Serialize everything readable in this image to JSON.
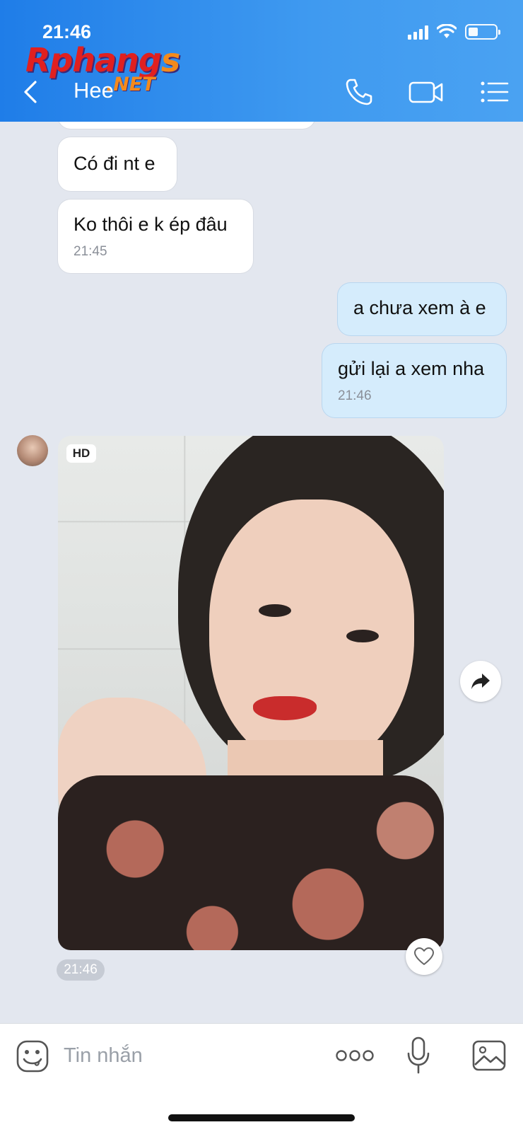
{
  "status_bar": {
    "time": "21:46"
  },
  "watermark": {
    "main": "Rphang",
    "s": "s",
    "suffix": ".NET"
  },
  "header": {
    "title": "Hee",
    "back_icon": "chevron-left-icon",
    "call_icon": "phone-icon",
    "video_icon": "video-camera-icon",
    "menu_icon": "list-menu-icon"
  },
  "messages": [
    {
      "direction": "in",
      "text": "Có đi nt e",
      "time": ""
    },
    {
      "direction": "in",
      "text": "Ko thôi e k ép đâu",
      "time": "21:45"
    },
    {
      "direction": "out",
      "text": "a chưa xem à e",
      "time": ""
    },
    {
      "direction": "out",
      "text": "gửi lại a xem nha",
      "time": "21:46"
    }
  ],
  "photo_message": {
    "badge": "HD",
    "time": "21:46",
    "like_icon": "heart-icon",
    "share_icon": "share-arrow-icon"
  },
  "input_bar": {
    "placeholder": "Tin nhắn",
    "emoji_icon": "emoji-icon",
    "more_icon": "more-dots-icon",
    "mic_icon": "microphone-icon",
    "image_icon": "image-icon"
  },
  "colors": {
    "header": "#2b8aec",
    "incoming": "#ffffff",
    "outgoing": "#d5ecfc",
    "background": "#e3e7ef"
  }
}
